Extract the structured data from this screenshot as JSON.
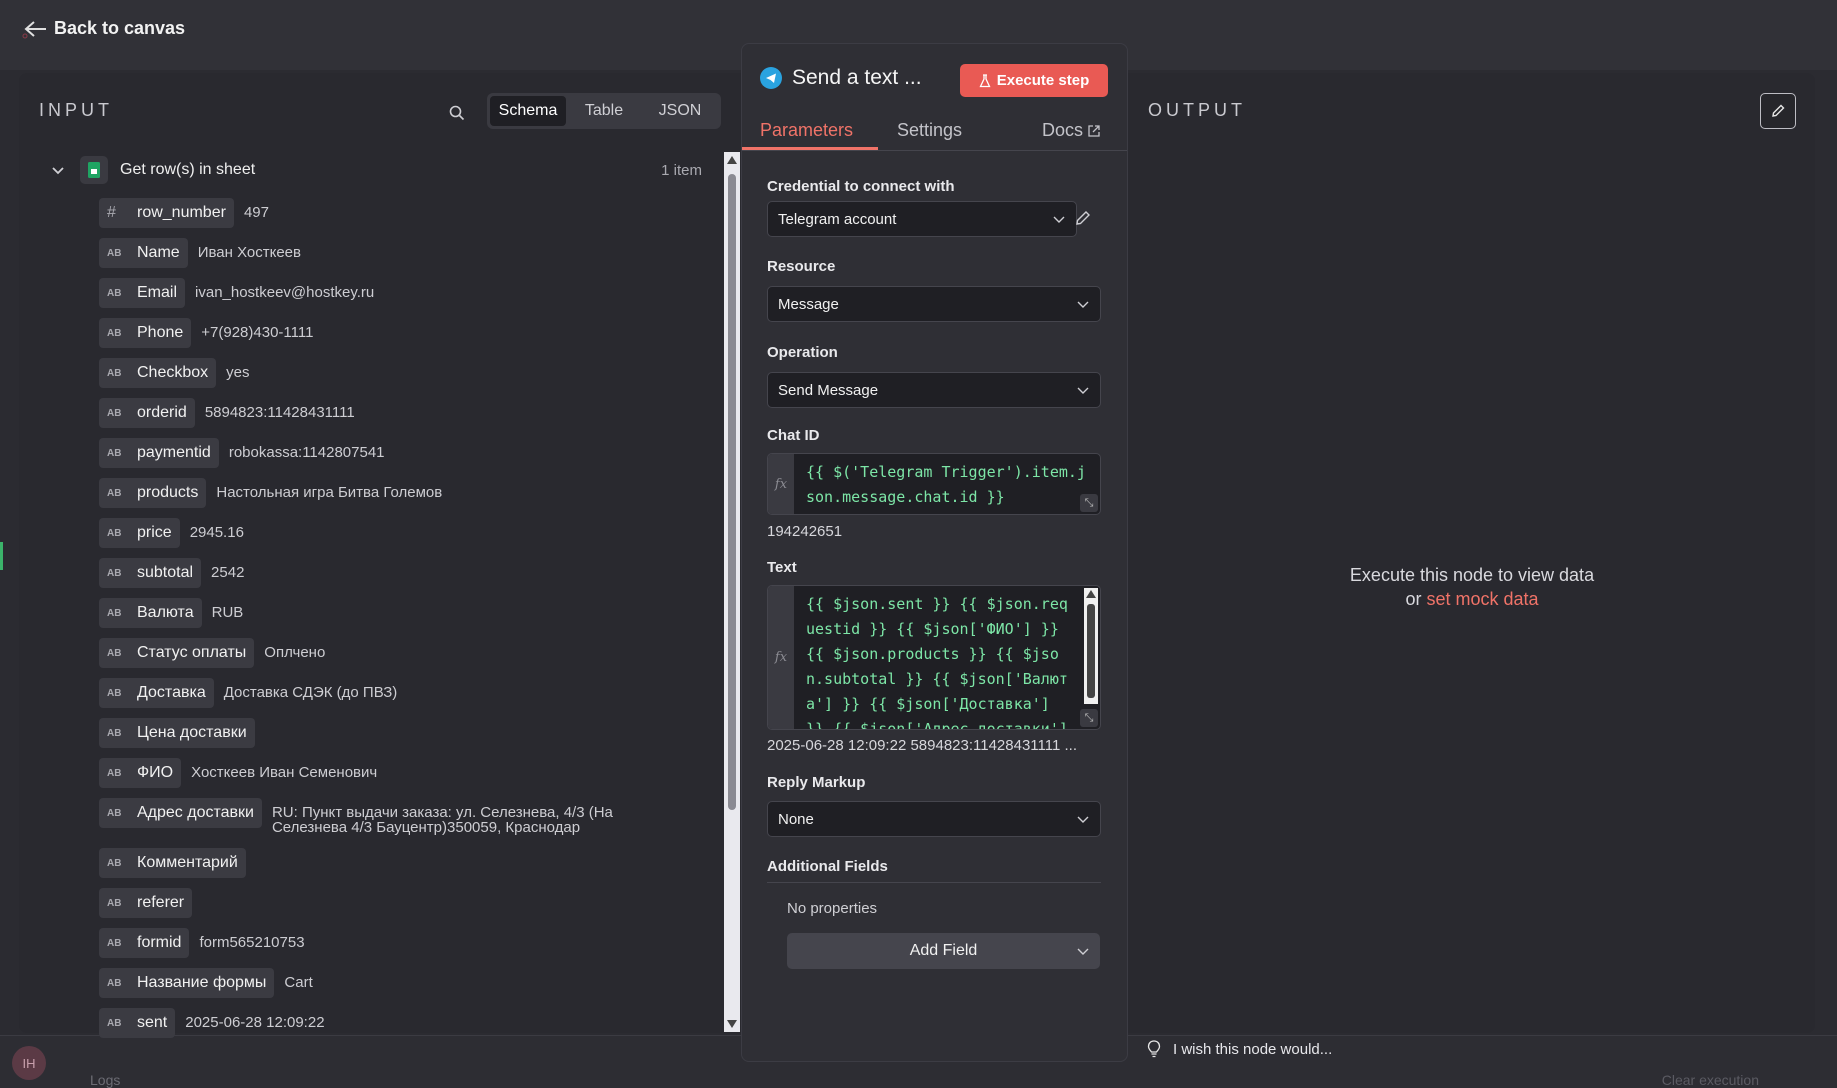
{
  "nav": {
    "back_label": "Back to canvas"
  },
  "input_panel": {
    "heading": "INPUT",
    "view_tabs": [
      "Schema",
      "Table",
      "JSON"
    ],
    "active_view": "Schema",
    "node_name": "Get row(s) in sheet",
    "item_count": "1 item",
    "fields": [
      {
        "type": "#",
        "name": "row_number",
        "value": "497"
      },
      {
        "type": "AB",
        "name": "Name",
        "value": "Иван Хосткеев"
      },
      {
        "type": "AB",
        "name": "Email",
        "value": "ivan_hostkeev@hostkey.ru"
      },
      {
        "type": "AB",
        "name": "Phone",
        "value": "+7(928)430-1111"
      },
      {
        "type": "AB",
        "name": "Checkbox",
        "value": "yes"
      },
      {
        "type": "AB",
        "name": "orderid",
        "value": "5894823:11428431111"
      },
      {
        "type": "AB",
        "name": "paymentid",
        "value": "robokassa:1142807541"
      },
      {
        "type": "AB",
        "name": "products",
        "value": "Настольная игра Битва Големов"
      },
      {
        "type": "AB",
        "name": "price",
        "value": "2945.16"
      },
      {
        "type": "AB",
        "name": "subtotal",
        "value": "2542"
      },
      {
        "type": "AB",
        "name": "Валюта",
        "value": "RUB"
      },
      {
        "type": "AB",
        "name": "Статус оплаты",
        "value": "Оплчено"
      },
      {
        "type": "AB",
        "name": "Доставка",
        "value": "Доставка СДЭК (до ПВЗ)"
      },
      {
        "type": "AB",
        "name": "Цена доставки",
        "value": ""
      },
      {
        "type": "AB",
        "name": "ФИО",
        "value": "Хосткеев Иван Семенович"
      },
      {
        "type": "AB",
        "name": "Адрес доставки",
        "value": "RU: Пункт выдачи заказа: ул. Селезнева, 4/3 (На Селезнева 4/3 Бауцентр)350059, Краснодар"
      },
      {
        "type": "AB",
        "name": "Комментарий",
        "value": ""
      },
      {
        "type": "AB",
        "name": "referer",
        "value": ""
      },
      {
        "type": "AB",
        "name": "formid",
        "value": "form565210753"
      },
      {
        "type": "AB",
        "name": "Название формы",
        "value": "Cart"
      },
      {
        "type": "AB",
        "name": "sent",
        "value": "2025-06-28 12:09:22"
      }
    ]
  },
  "node_panel": {
    "title": "Send a text ...",
    "execute_label": "Execute step",
    "tabs": {
      "parameters": "Parameters",
      "settings": "Settings",
      "docs": "Docs"
    },
    "credential_label": "Credential to connect with",
    "credential_value": "Telegram account",
    "resource_label": "Resource",
    "resource_value": "Message",
    "operation_label": "Operation",
    "operation_value": "Send Message",
    "chat_id_label": "Chat ID",
    "chat_id_expr": "{{ $('Telegram Trigger').item.json.message.chat.id }}",
    "chat_id_result": "194242651",
    "text_label": "Text",
    "text_expr": "{{ $json.sent }} {{ $json.requestid }} {{ $json['ФИО'] }} {{ $json.products }} {{ $json.subtotal }} {{ $json['Валюта'] }} {{ $json['Доставка'] }} {{ $json['Адрес доставки'] }}",
    "text_result": "2025-06-28 12:09:22 5894823:11428431111 ...",
    "reply_markup_label": "Reply Markup",
    "reply_markup_value": "None",
    "additional_fields_label": "Additional Fields",
    "no_properties": "No properties",
    "add_field_label": "Add Field",
    "fx_label": "fx"
  },
  "output_panel": {
    "heading": "OUTPUT",
    "empty_line1": "Execute this node to view data",
    "empty_or": "or",
    "mock_link": "set mock data"
  },
  "footer": {
    "wish_text": "I wish this node would...",
    "logs_label": "Logs",
    "clear_execution": "Clear execution",
    "avatar_initials": "IH"
  },
  "colors": {
    "accent": "#f07368",
    "execute": "#e95a54",
    "code": "#7de6a7",
    "telegram": "#2aa3e0",
    "sheets": "#1fa463"
  }
}
